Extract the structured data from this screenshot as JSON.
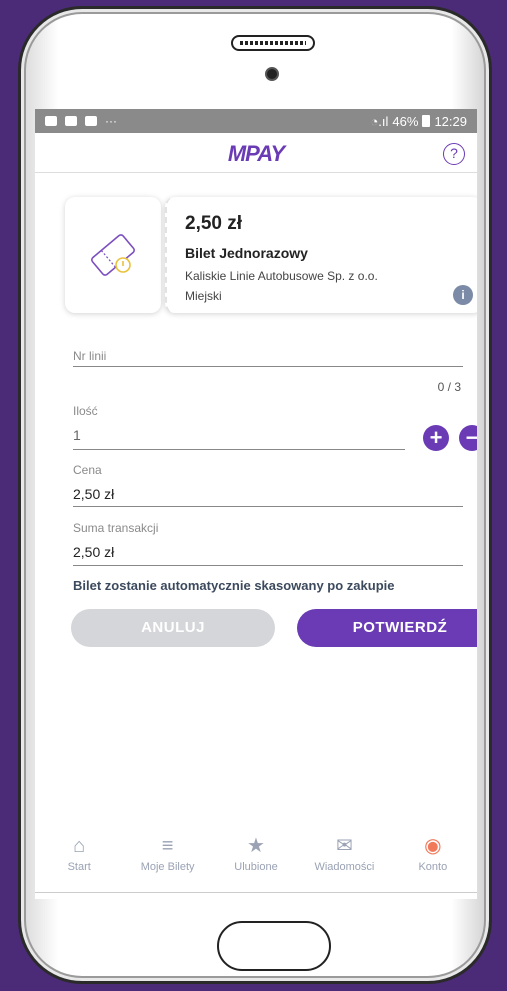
{
  "status": {
    "signal": "὏6",
    "battery_pct": "46%",
    "time": "12:29"
  },
  "app": {
    "logo": "MPAY",
    "help_icon": "?"
  },
  "ticket": {
    "price": "2,50 zł",
    "name": "Bilet Jednorazowy",
    "operator": "Kaliskie Linie Autobusowe Sp. z o.o.",
    "zone": "Miejski",
    "info_icon": "i"
  },
  "form": {
    "line_label": "Nr linii",
    "line_counter": "0 / 3",
    "qty_label": "Ilość",
    "qty_value": "1",
    "price_label": "Cena",
    "price_value": "2,50 zł",
    "total_label": "Suma transakcji",
    "total_value": "2,50 zł",
    "note": "Bilet zostanie automatycznie skasowany po zakupie"
  },
  "buttons": {
    "cancel": "ANULUJ",
    "confirm": "POTWIERDŹ",
    "plus": "+",
    "minus": "−"
  },
  "tabs": [
    {
      "label": "Start",
      "icon": "home-icon",
      "glyph": "⌂"
    },
    {
      "label": "Moje Bilety",
      "icon": "tickets-icon",
      "glyph": "≡"
    },
    {
      "label": "Ulubione",
      "icon": "star-icon",
      "glyph": "★"
    },
    {
      "label": "Wiadomości",
      "icon": "mail-icon",
      "glyph": "✉"
    },
    {
      "label": "Konto",
      "icon": "account-icon",
      "glyph": "◉"
    }
  ],
  "colors": {
    "accent": "#6a3bb5",
    "active_tab": "#f07a5a",
    "background": "#4b2a78"
  }
}
